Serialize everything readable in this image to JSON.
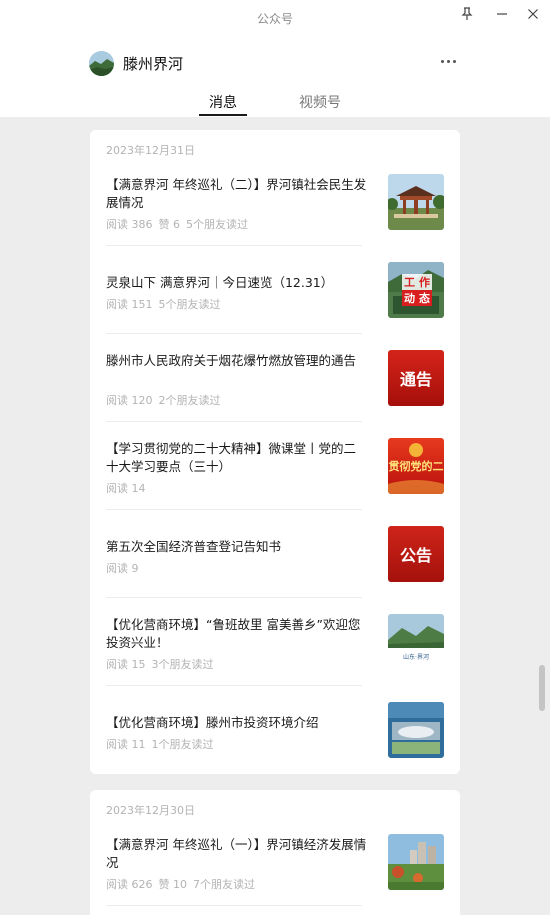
{
  "window": {
    "title": "公众号"
  },
  "account": {
    "name": "滕州界河"
  },
  "tabs": [
    {
      "label": "消息",
      "active": true
    },
    {
      "label": "视频号",
      "active": false
    }
  ],
  "cards": [
    {
      "date": "2023年12月31日",
      "articles": [
        {
          "title": "【满意界河 年终巡礼（二）】界河镇社会民生发展情况",
          "stats": [
            "阅读 386",
            "赞 6",
            "5个朋友读过"
          ],
          "thumb": "pavilion-photo"
        },
        {
          "title": "灵泉山下 满意界河｜今日速览（12.31）",
          "stats": [
            "阅读 151",
            "5个朋友读过"
          ],
          "thumb": "work-news-photo",
          "thumb_text": [
            "工",
            "作",
            "动",
            "态"
          ]
        },
        {
          "title": "滕州市人民政府关于烟花爆竹燃放管理的通告",
          "stats": [
            "阅读 120",
            "2个朋友读过"
          ],
          "thumb": "notice-red",
          "thumb_text": "通告"
        },
        {
          "title": "【学习贯彻党的二十大精神】微课堂丨党的二十大学习要点（三十）",
          "stats": [
            "阅读 14"
          ],
          "thumb": "party-red",
          "thumb_text": "贯彻党的二"
        },
        {
          "title": "第五次全国经济普查登记告知书",
          "stats": [
            "阅读 9"
          ],
          "thumb": "announcement-red",
          "thumb_text": "公告"
        },
        {
          "title": "【优化营商环境】“鲁班故里 富美善乡”欢迎您投资兴业！",
          "stats": [
            "阅读 15",
            "3个朋友读过"
          ],
          "thumb": "landscape-photo",
          "thumb_text": "山东·界河"
        },
        {
          "title": "【优化营商环境】滕州市投资环境介绍",
          "stats": [
            "阅读 11",
            "1个朋友读过"
          ],
          "thumb": "aerial-photo"
        }
      ]
    },
    {
      "date": "2023年12月30日",
      "articles": [
        {
          "title": "【满意界河 年终巡礼（一）】界河镇经济发展情况",
          "stats": [
            "阅读 626",
            "赞 10",
            "7个朋友读过"
          ],
          "thumb": "town-photo"
        }
      ]
    }
  ],
  "icons": {
    "pin": "pin-icon",
    "minimize": "minimize-icon",
    "close": "close-icon",
    "more": "more-dots-icon"
  },
  "colors": {
    "feed_background": "#ededed",
    "card_background": "#ffffff",
    "notice_red": "#c3170f"
  }
}
